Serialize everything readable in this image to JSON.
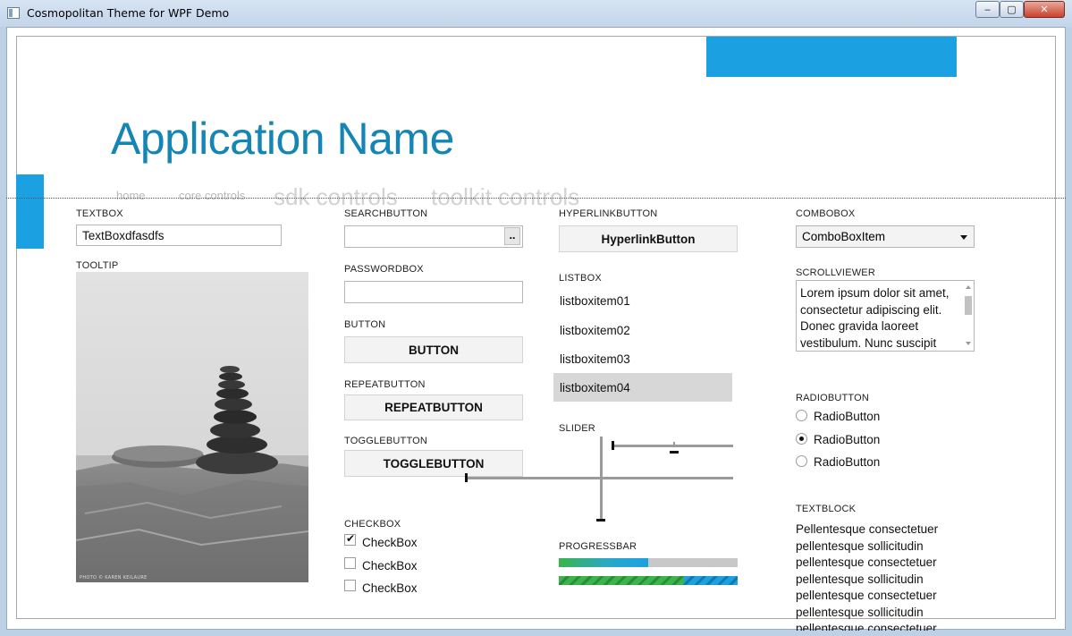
{
  "window": {
    "title": "Cosmopolitan Theme for WPF Demo",
    "minimize": "‒",
    "maximize": "▢",
    "close": "✕"
  },
  "header": {
    "app_name": "Application Name",
    "nav": [
      "home",
      "core controls",
      "sdk controls",
      "toolkit controls"
    ]
  },
  "colors": {
    "accent": "#1ba1e2",
    "title": "#1585b5"
  },
  "textbox": {
    "label": "TEXTBOX",
    "value": "TextBoxdfasdfs"
  },
  "tooltip": {
    "label": "TOOLTIP",
    "photo_credit": "PHOTO © KAREN KEILAURE"
  },
  "searchbutton": {
    "label": "SEARCHBUTTON",
    "value": "",
    "icon": "ellipsis-icon",
    "glyph": "․․"
  },
  "passwordbox": {
    "label": "PASSWORDBOX",
    "value": ""
  },
  "button": {
    "label": "BUTTON",
    "text": "BUTTON"
  },
  "repeatbutton": {
    "label": "REPEATBUTTON",
    "text": "REPEATBUTTON"
  },
  "togglebutton": {
    "label": "TOGGLEBUTTON",
    "text": "TOGGLEBUTTON"
  },
  "checkbox": {
    "label": "CHECKBOX",
    "items": [
      {
        "text": "CheckBox",
        "checked": true,
        "mark": "✔"
      },
      {
        "text": "CheckBox",
        "checked": false,
        "mark": ""
      },
      {
        "text": "CheckBox",
        "checked": false,
        "mark": ""
      }
    ]
  },
  "hyperlinkbutton": {
    "label": "HYPERLINKBUTTON",
    "text": "HyperlinkButton"
  },
  "listbox": {
    "label": "LISTBOX",
    "items": [
      "listboxitem01",
      "listboxitem02",
      "listboxitem03",
      "listboxitem04"
    ],
    "selected_index": 3
  },
  "slider": {
    "label": "SLIDER",
    "horizontal_value": 0.0,
    "vertical_value": 0.0
  },
  "progressbar": {
    "label": "PROGRESSBAR",
    "value_percent": 50,
    "indeterminate": true
  },
  "combobox": {
    "label": "COMBOBOX",
    "selected": "ComboBoxItem"
  },
  "scrollviewer": {
    "label": "SCROLLVIEWER",
    "text": "Lorem ipsum dolor sit amet, consectetur adipiscing elit. Donec gravida laoreet vestibulum. Nunc suscipit"
  },
  "radiobutton": {
    "label": "RADIOBUTTON",
    "items": [
      {
        "text": "RadioButton",
        "checked": false
      },
      {
        "text": "RadioButton",
        "checked": true
      },
      {
        "text": "RadioButton",
        "checked": false
      }
    ]
  },
  "textblock": {
    "label": "TEXTBLOCK",
    "text": "Pellentesque consectetuer pellentesque sollicitudin pellentesque consectetuer pellentesque sollicitudin pellentesque consectetuer pellentesque sollicitudin pellentesque consectetuer"
  }
}
